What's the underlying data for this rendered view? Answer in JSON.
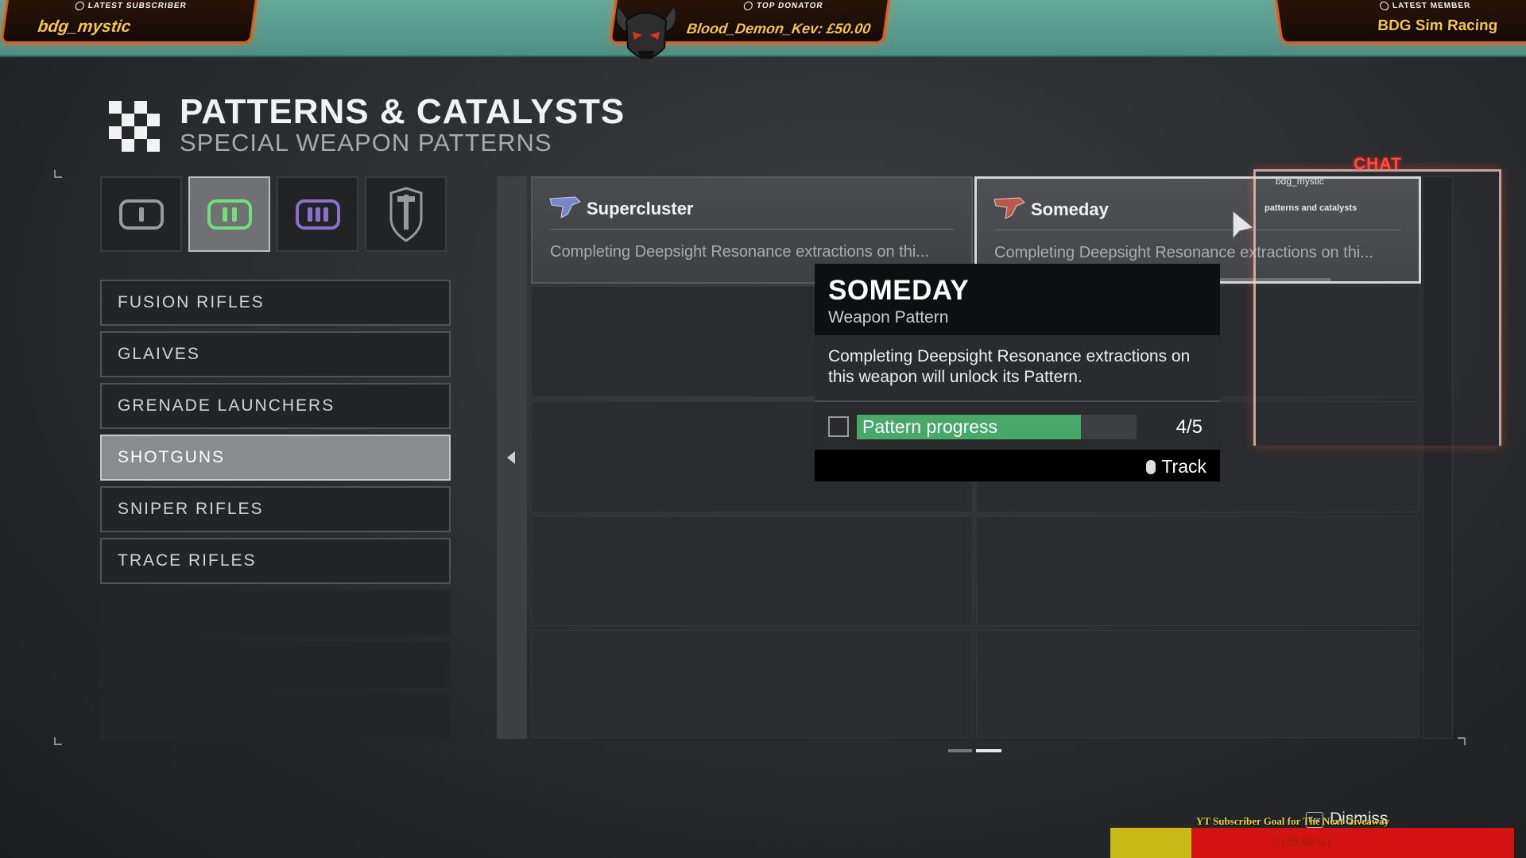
{
  "overlay": {
    "latest_subscriber": {
      "label": "LATEST SUBSCRIBER",
      "name": "bdg_mystic"
    },
    "top_donator": {
      "label": "TOP DONATOR",
      "text": "Blood_Demon_Kev: £50.00"
    },
    "latest_member": {
      "label": "LATEST MEMBER",
      "name": "BDG Sim Racing"
    },
    "chat": {
      "label": "CHAT",
      "user": "bdg_mystic",
      "message": "patterns and catalysts"
    },
    "goal": {
      "title": "YT Subscriber Goal for The Next Giveaway",
      "text": "5 (20.00%)",
      "progress": 0.2,
      "fill_color": "#c8bb15",
      "bg_color": "#d41212"
    }
  },
  "header": {
    "title": "PATTERNS & CATALYSTS",
    "subtitle": "SPECIAL WEAPON PATTERNS",
    "icon": "checker-icon"
  },
  "filter_tabs": [
    {
      "name": "kinetic-ammo-icon",
      "selected": false,
      "color": "#9a9a9a"
    },
    {
      "name": "special-ammo-icon",
      "selected": true,
      "color": "#6fe07a"
    },
    {
      "name": "heavy-ammo-icon",
      "selected": false,
      "color": "#8c6fc7"
    },
    {
      "name": "shield-icon",
      "selected": false,
      "color": "#9a9a9a"
    }
  ],
  "categories": [
    {
      "label": "FUSION RIFLES",
      "selected": false
    },
    {
      "label": "GLAIVES",
      "selected": false
    },
    {
      "label": "GRENADE LAUNCHERS",
      "selected": false
    },
    {
      "label": "SHOTGUNS",
      "selected": true
    },
    {
      "label": "SNIPER RIFLES",
      "selected": false
    },
    {
      "label": "TRACE RIFLES",
      "selected": false
    }
  ],
  "patterns": [
    {
      "name": "Supercluster",
      "description": "Completing Deepsight Resonance extractions on thi...",
      "icon": "shotgun-icon"
    },
    {
      "name": "Someday",
      "description": "Completing Deepsight Resonance extractions on thi...",
      "icon": "shotgun-icon",
      "progress": 0.8
    }
  ],
  "tooltip": {
    "title": "SOMEDAY",
    "type": "Weapon Pattern",
    "description": "Completing Deepsight Resonance extractions on this weapon will unlock its Pattern.",
    "progress_label": "Pattern progress",
    "progress_count": "4/5",
    "progress_fraction": 0.8,
    "progress_color": "#47a86a",
    "track_label": "Track"
  },
  "footer": {
    "dismiss_label": "Dismiss",
    "esc_key": "Esc"
  }
}
